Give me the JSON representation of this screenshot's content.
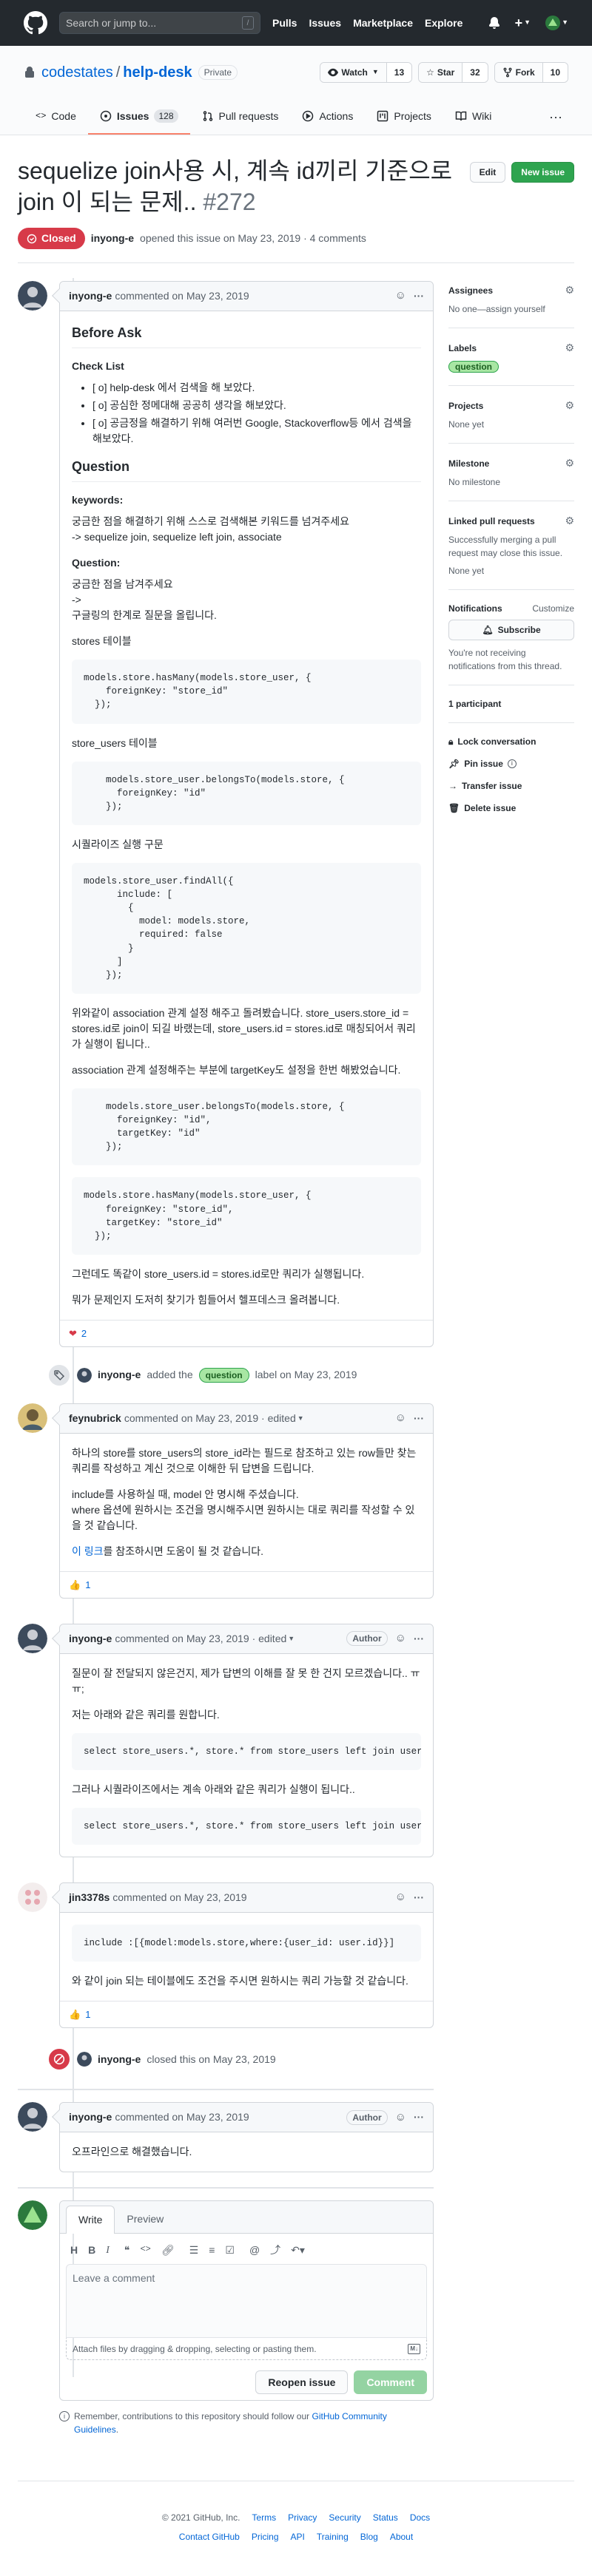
{
  "header": {
    "search_placeholder": "Search or jump to...",
    "slash": "/",
    "nav": [
      "Pulls",
      "Issues",
      "Marketplace",
      "Explore"
    ]
  },
  "repo": {
    "owner": "codestates",
    "sep": "/",
    "name": "help-desk",
    "visibility": "Private",
    "watch_label": "Watch",
    "watch_count": "13",
    "star_label": "Star",
    "star_count": "32",
    "fork_label": "Fork",
    "fork_count": "10",
    "tabs": [
      {
        "label": "Code"
      },
      {
        "label": "Issues",
        "count": "128"
      },
      {
        "label": "Pull requests"
      },
      {
        "label": "Actions"
      },
      {
        "label": "Projects"
      },
      {
        "label": "Wiki"
      }
    ],
    "more": "···"
  },
  "issue": {
    "title": "sequelize join사용 시, 계속 id끼리 기준으로 join 이 되는 문제..",
    "number": "#272",
    "edit_label": "Edit",
    "new_issue_label": "New issue",
    "state": "Closed",
    "author": "inyong-e",
    "opened_text": "opened this issue on May 23, 2019 · 4 comments"
  },
  "comment1": {
    "author": "inyong-e",
    "meta": "commented on May 23, 2019",
    "h_before": "Before Ask",
    "h_checklist": "Check List",
    "checklist": [
      "[ o] help-desk 에서 검색을 해 보았다.",
      "[ o] 공심한 정메대해 공공히 생각을 해보았다.",
      "[ o] 공금정을 해결하기 위해 여러번 Google, Stackoverflow등 에서 검색을 해보았다."
    ],
    "h_question": "Question",
    "keywords_title": "keywords:",
    "keywords_desc": "궁금한 점을 해결하기 위해 스스로 검색해본 키워드를 넘겨주세요",
    "keywords_list": "-> sequelize join, sequelize left join, associate",
    "question_title": "Question:",
    "question_l1": "궁금한 점을 남겨주세요",
    "question_l2": "->",
    "question_l3": "구글링의 한계로 질문을 올립니다.",
    "stores_table": "stores 테이블",
    "code1": "models.store.hasMany(models.store_user, {\n    foreignKey: \"store_id\"\n  });",
    "store_users_table": "store_users 테이블",
    "code2": "    models.store_user.belongsTo(models.store, {\n      foreignKey: \"id\"\n    });",
    "sequelize_exec": "시퀄라이즈 실행 구문",
    "code3": "models.store_user.findAll({\n      include: [\n        {\n          model: models.store,\n          required: false\n        }\n      ]\n    });",
    "p_explain": "위와같이 association 관계 설정 해주고 돌려봤습니다. store_users.store_id = stores.id로 join이 되길 바랬는데, store_users.id = stores.id로 매칭되어서 쿼리가 실행이 됩니다..",
    "p_targetkey": "association 관계 설정해주는 부분에 targetKey도 설정을 한번 해봤었습니다.",
    "code4": "    models.store_user.belongsTo(models.store, {\n      foreignKey: \"id\",\n      targetKey: \"id\"\n    });",
    "code5": "models.store.hasMany(models.store_user, {\n    foreignKey: \"store_id\",\n    targetKey: \"store_id\"\n  });",
    "p_still": "그런데도 똑같이 store_users.id = stores.id로만 쿼리가 실행됩니다.",
    "p_unknown": "뭐가 문제인지 도저히 찾기가 힘들어서 헬프데스크 올려봅니다.",
    "reaction_count": "2"
  },
  "label_event": {
    "actor": "inyong-e",
    "pre": "added the",
    "label": "question",
    "post": "label on May 23, 2019"
  },
  "comment2": {
    "author": "feynubrick",
    "meta": "commented on May 23, 2019 · edited",
    "p1": "하나의 store를 store_users의 store_id라는 필드로 참조하고 있는 row들만 찾는 쿼리를 작성하고 계신 것으로 이해한 뒤 답변을 드립니다.",
    "p2": "include를 사용하실 때, model 안 명시해 주셨습니다.",
    "p3": "where 옵션에 원하시는 조건을 명시해주시면 원하시는 대로 쿼리를 작성할 수 있을 것 같습니다.",
    "link": "이 링크",
    "p4": "를 참조하시면 도움이 될 것 같습니다.",
    "reaction_count": "1"
  },
  "comment3": {
    "author": "inyong-e",
    "meta": "commented on May 23, 2019 · edited",
    "badge": "Author",
    "p1": "질문이 잘 전달되지 않은건지, 제가 답변의 이해를 잘 못 한 건지 모르겠습니다.. ㅠㅠ;",
    "p2": "저는 아래와 같은 쿼리를 원합니다.",
    "code1": "select store_users.*, store.* from store_users left join users on store_users.store_id = stores.id",
    "p3": "그러나 시퀄라이즈에서는 계속 아래와 같은 쿼리가 실행이 됩니다..",
    "code2": "select store_users.*, store.* from store_users left join users on store_users.id = stores.id"
  },
  "comment4": {
    "author": "jin3378s",
    "meta": "commented on May 23, 2019",
    "code": "include :[{model:models.store,where:{user_id: user.id}}]",
    "p1": "와 같이 join 되는 테이블에도 조건을 주시면 원하시는 쿼리 가능할 것 같습니다.",
    "reaction_count": "1"
  },
  "close_event": {
    "actor": "inyong-e",
    "text": "closed this on May 23, 2019"
  },
  "comment5": {
    "author": "inyong-e",
    "meta": "commented on May 23, 2019",
    "badge": "Author",
    "p1": "오프라인으로 해결했습니다."
  },
  "new_comment": {
    "tab_write": "Write",
    "tab_preview": "Preview",
    "placeholder": "Leave a comment",
    "attach": "Attach files by dragging & dropping, selecting or pasting them.",
    "reopen": "Reopen issue",
    "submit": "Comment",
    "remember_pre": "Remember, contributions to this repository should follow our ",
    "remember_link": "GitHub Community Guidelines",
    "remember_post": "."
  },
  "sidebar": {
    "assignees_title": "Assignees",
    "assignees_text": "No one—assign yourself",
    "labels_title": "Labels",
    "label": "question",
    "projects_title": "Projects",
    "projects_text": "None yet",
    "milestone_title": "Milestone",
    "milestone_text": "No milestone",
    "linked_title": "Linked pull requests",
    "linked_desc": "Successfully merging a pull request may close this issue.",
    "linked_text": "None yet",
    "notifications_title": "Notifications",
    "customize": "Customize",
    "subscribe": "Subscribe",
    "notif_desc": "You're not receiving notifications from this thread.",
    "participants": "1 participant",
    "lock": "Lock conversation",
    "pin": "Pin issue",
    "transfer": "Transfer issue",
    "delete": "Delete issue"
  },
  "footer": {
    "row1": [
      "© 2021 GitHub, Inc.",
      "Terms",
      "Privacy",
      "Security",
      "Status",
      "Docs"
    ],
    "row2": [
      "Contact GitHub",
      "Pricing",
      "API",
      "Training",
      "Blog",
      "About"
    ]
  },
  "colors": {
    "closed": "#d73a49",
    "green": "#2ea44f",
    "link": "#0366d6",
    "tab_underline": "#f9826c"
  }
}
